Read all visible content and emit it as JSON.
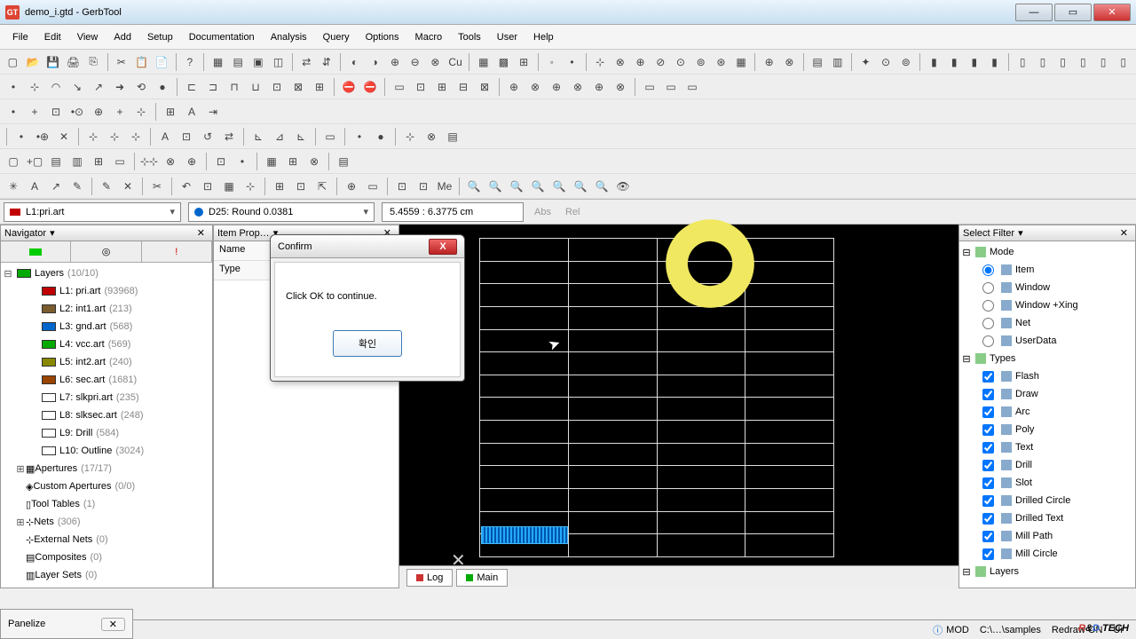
{
  "window": {
    "title": "demo_i.gtd - GerbTool",
    "icon_text": "GT"
  },
  "menu": [
    "File",
    "Edit",
    "View",
    "Add",
    "Setup",
    "Documentation",
    "Analysis",
    "Query",
    "Options",
    "Macro",
    "Tools",
    "User",
    "Help"
  ],
  "combo": {
    "layer": "L1:pri.art",
    "aperture": "D25: Round 0.0381",
    "readout": "5.4559 : 6.3775 cm",
    "abs": "Abs",
    "rel": "Rel"
  },
  "navigator": {
    "title": "Navigator",
    "layers_label": "Layers",
    "layers_count": "(10/10)",
    "layers": [
      {
        "name": "L1: pri.art",
        "count": "(93968)",
        "color": "#c00000"
      },
      {
        "name": "L2: int1.art",
        "count": "(213)",
        "color": "#7a5c2e"
      },
      {
        "name": "L3: gnd.art",
        "count": "(568)",
        "color": "#0066cc"
      },
      {
        "name": "L4: vcc.art",
        "count": "(569)",
        "color": "#00aa00"
      },
      {
        "name": "L5: int2.art",
        "count": "(240)",
        "color": "#888800"
      },
      {
        "name": "L6: sec.art",
        "count": "(1681)",
        "color": "#994400"
      },
      {
        "name": "L7: slkpri.art",
        "count": "(235)",
        "color": "#ffffff"
      },
      {
        "name": "L8: slksec.art",
        "count": "(248)",
        "color": "#ffffff"
      },
      {
        "name": "L9: Drill",
        "count": "(584)",
        "color": "#ffffff"
      },
      {
        "name": "L10: Outline",
        "count": "(3024)",
        "color": "#ffffff"
      }
    ],
    "other": [
      {
        "label": "Apertures",
        "count": "(17/17)"
      },
      {
        "label": "Custom Apertures",
        "count": "(0/0)"
      },
      {
        "label": "Tool Tables",
        "count": "(1)"
      },
      {
        "label": "Nets",
        "count": "(306)"
      },
      {
        "label": "External Nets",
        "count": "(0)"
      },
      {
        "label": "Composites",
        "count": "(0)"
      },
      {
        "label": "Layer Sets",
        "count": "(0)"
      }
    ]
  },
  "props": {
    "title": "Item Prop…",
    "name": "Name",
    "type": "Type"
  },
  "canvas": {
    "tab_log": "Log",
    "tab_main": "Main"
  },
  "filter": {
    "title": "Select Filter",
    "mode_label": "Mode",
    "modes": [
      "Item",
      "Window",
      "Window +Xing",
      "Net",
      "UserData"
    ],
    "types_label": "Types",
    "types": [
      "Flash",
      "Draw",
      "Arc",
      "Poly",
      "Text",
      "Drill",
      "Slot",
      "Drilled Circle",
      "Drilled Text",
      "Mill Path",
      "Mill Circle"
    ],
    "layers_label": "Layers"
  },
  "dialog": {
    "title": "Confirm",
    "message": "Click OK to continue.",
    "ok": "확인"
  },
  "panelize": {
    "label": "Panelize"
  },
  "status": {
    "mod": "MOD",
    "path": "C:\\…\\samples",
    "redraw": "Redraw ON",
    "ur": "Ur"
  },
  "logo": {
    "r": "R",
    "amp": "&",
    "d": "D",
    "tech": " TECH"
  }
}
